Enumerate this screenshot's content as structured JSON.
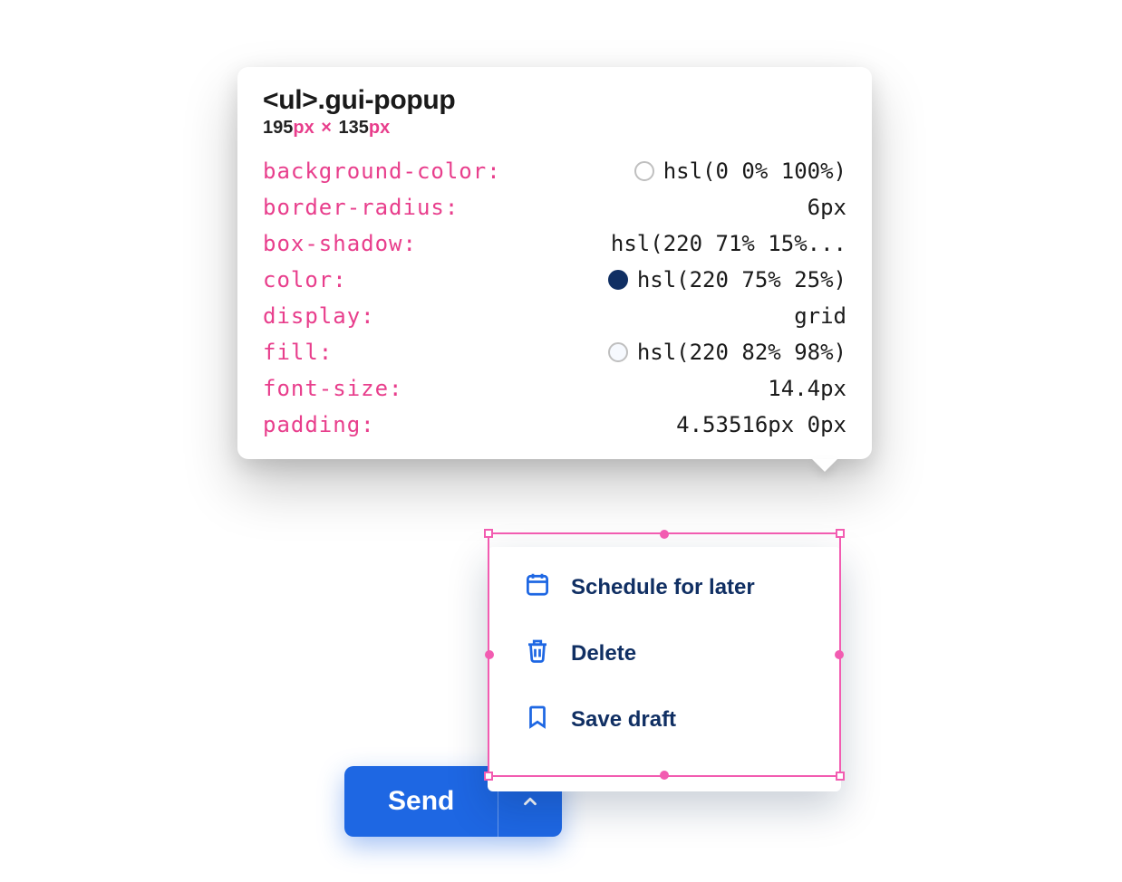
{
  "tooltip": {
    "selector_tag": "<ul>",
    "selector_class": ".gui-popup",
    "dim_w": "195",
    "dim_h": "135",
    "dim_unit": "px",
    "dim_sep": "×",
    "props": [
      {
        "key": "background-color",
        "value": "hsl(0 0% 100%)",
        "swatch": "#ffffff",
        "swatch_border": true
      },
      {
        "key": "border-radius",
        "value": "6px"
      },
      {
        "key": "box-shadow",
        "value": "hsl(220 71% 15%..."
      },
      {
        "key": "color",
        "value": "hsl(220 75% 25%)",
        "swatch": "#102f63",
        "swatch_border": false
      },
      {
        "key": "display",
        "value": "grid"
      },
      {
        "key": "fill",
        "value": "hsl(220 82% 98%)",
        "swatch": "#f6f9fe",
        "swatch_border": true
      },
      {
        "key": "font-size",
        "value": "14.4px"
      },
      {
        "key": "padding",
        "value": "4.53516px 0px"
      }
    ]
  },
  "popup": {
    "items": [
      {
        "icon": "calendar-icon",
        "label": "Schedule for later"
      },
      {
        "icon": "trash-icon",
        "label": "Delete"
      },
      {
        "icon": "bookmark-icon",
        "label": "Save draft"
      }
    ]
  },
  "send": {
    "label": "Send"
  },
  "colors": {
    "accent_pink": "#e83e8c",
    "select_pink": "#f25cb1",
    "brand_blue": "#1e67e3",
    "text_navy": "#102f63"
  }
}
